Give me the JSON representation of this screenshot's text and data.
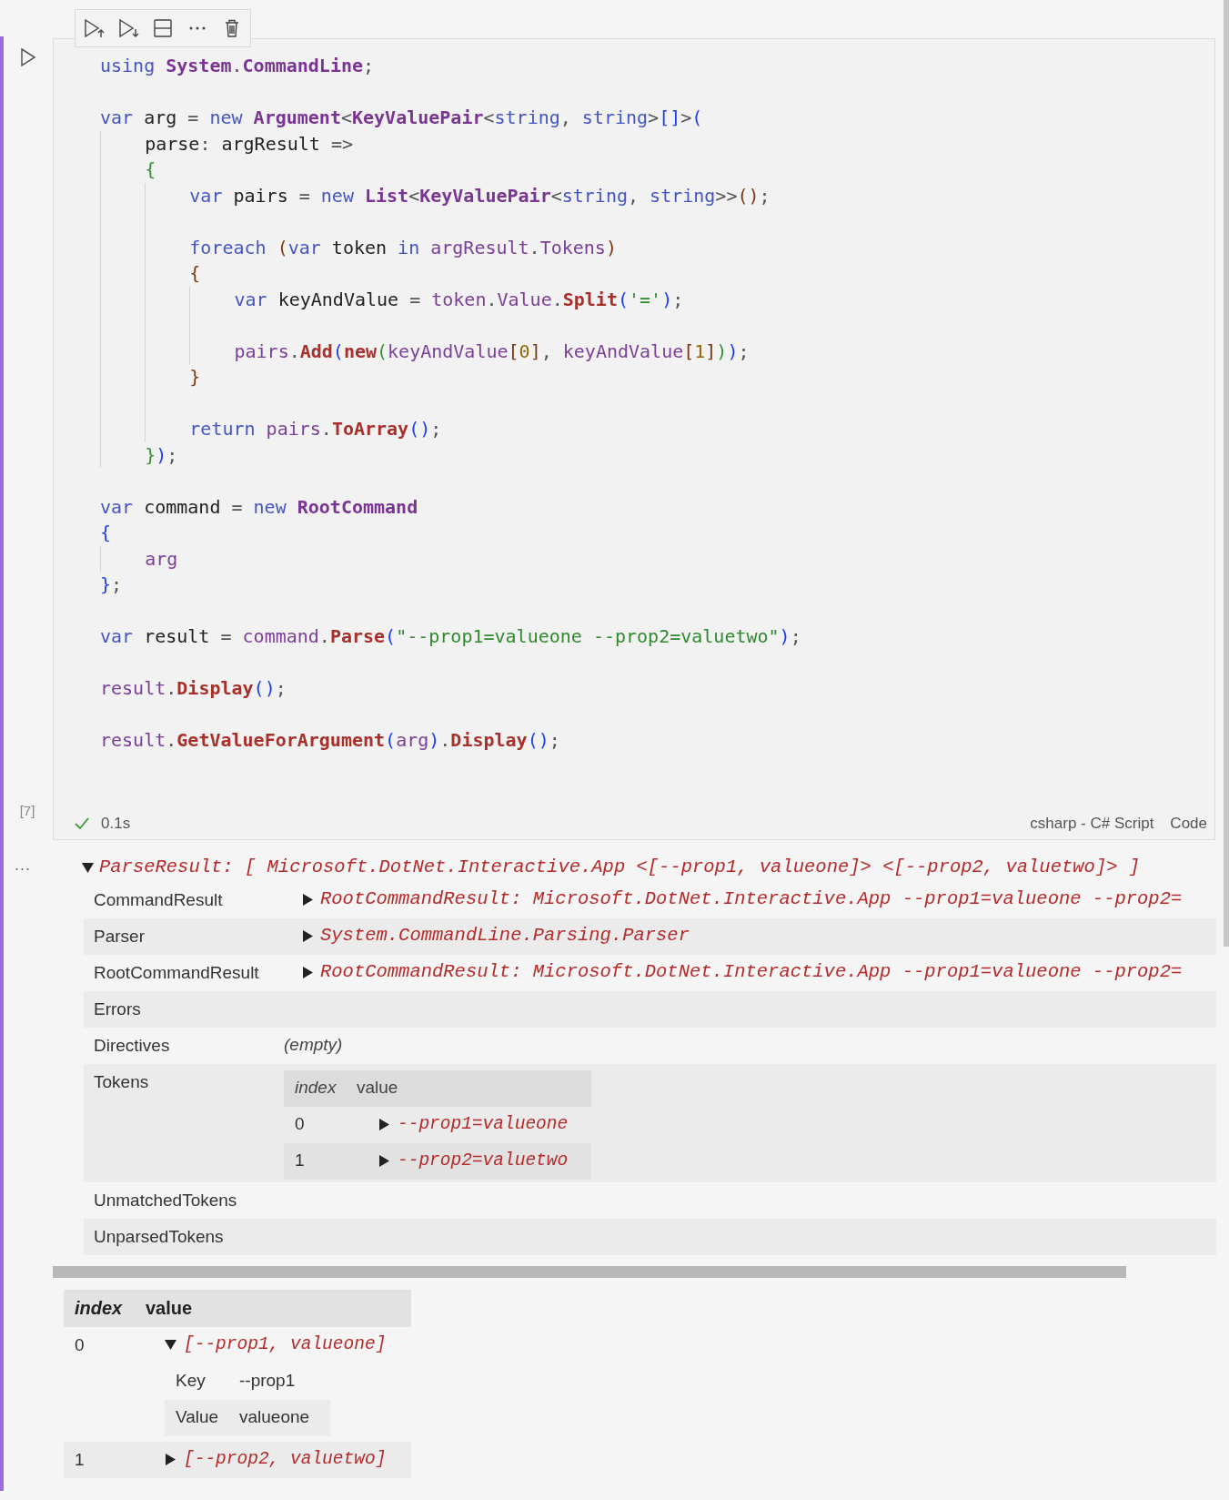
{
  "cell": {
    "execution_count": "[7]",
    "succeeded": true,
    "duration": "0.1s",
    "language": "csharp - C# Script",
    "cell_type": "Code",
    "code": [
      {
        "kind": "code",
        "tokens": [
          {
            "kind": "kw",
            "text": "using "
          },
          {
            "kind": "type",
            "text": "System"
          },
          {
            "kind": "p",
            "text": "."
          },
          {
            "kind": "type",
            "text": "CommandLine"
          },
          {
            "kind": "p",
            "text": ";"
          }
        ]
      },
      {
        "kind": "blank"
      },
      {
        "kind": "code",
        "tokens": [
          {
            "kind": "kw",
            "text": "var"
          },
          {
            "kind": "id",
            "text": " arg"
          },
          {
            "kind": "p",
            "text": " = "
          },
          {
            "kind": "kw",
            "text": "new "
          },
          {
            "kind": "type",
            "text": "Argument"
          },
          {
            "kind": "p",
            "text": "<"
          },
          {
            "kind": "type",
            "text": "KeyValuePair"
          },
          {
            "kind": "p",
            "text": "<"
          },
          {
            "kind": "kw",
            "text": "string"
          },
          {
            "kind": "p",
            "text": ", "
          },
          {
            "kind": "kw",
            "text": "string"
          },
          {
            "kind": "p",
            "text": ">"
          },
          {
            "kind": "b1",
            "text": "[]"
          },
          {
            "kind": "p",
            "text": ">"
          },
          {
            "kind": "b1",
            "text": "("
          }
        ]
      },
      {
        "kind": "block",
        "lines": [
          {
            "kind": "code",
            "tokens": [
              {
                "kind": "id",
                "text": "parse"
              },
              {
                "kind": "p",
                "text": ": "
              },
              {
                "kind": "id",
                "text": "argResult"
              },
              {
                "kind": "p",
                "text": " =>"
              }
            ]
          },
          {
            "kind": "code",
            "tokens": [
              {
                "kind": "b2",
                "text": "{"
              }
            ]
          },
          {
            "kind": "block",
            "lines": [
              {
                "kind": "code",
                "tokens": [
                  {
                    "kind": "kw",
                    "text": "var"
                  },
                  {
                    "kind": "id",
                    "text": " pairs"
                  },
                  {
                    "kind": "p",
                    "text": " = "
                  },
                  {
                    "kind": "kw",
                    "text": "new "
                  },
                  {
                    "kind": "type",
                    "text": "List"
                  },
                  {
                    "kind": "p",
                    "text": "<"
                  },
                  {
                    "kind": "type",
                    "text": "KeyValuePair"
                  },
                  {
                    "kind": "p",
                    "text": "<"
                  },
                  {
                    "kind": "kw",
                    "text": "string"
                  },
                  {
                    "kind": "p",
                    "text": ", "
                  },
                  {
                    "kind": "kw",
                    "text": "string"
                  },
                  {
                    "kind": "p",
                    "text": ">>"
                  },
                  {
                    "kind": "b3",
                    "text": "()"
                  },
                  {
                    "kind": "p",
                    "text": ";"
                  }
                ]
              },
              {
                "kind": "blank"
              },
              {
                "kind": "code",
                "tokens": [
                  {
                    "kind": "kw",
                    "text": "foreach "
                  },
                  {
                    "kind": "b3",
                    "text": "("
                  },
                  {
                    "kind": "kw",
                    "text": "var"
                  },
                  {
                    "kind": "id",
                    "text": " token "
                  },
                  {
                    "kind": "kw",
                    "text": "in "
                  },
                  {
                    "kind": "mem",
                    "text": "argResult"
                  },
                  {
                    "kind": "p",
                    "text": "."
                  },
                  {
                    "kind": "mem",
                    "text": "Tokens"
                  },
                  {
                    "kind": "b3",
                    "text": ")"
                  }
                ]
              },
              {
                "kind": "code",
                "tokens": [
                  {
                    "kind": "b3",
                    "text": "{"
                  }
                ]
              },
              {
                "kind": "block",
                "lines": [
                  {
                    "kind": "code",
                    "tokens": [
                      {
                        "kind": "kw",
                        "text": "var"
                      },
                      {
                        "kind": "id",
                        "text": " keyAndValue"
                      },
                      {
                        "kind": "p",
                        "text": " = "
                      },
                      {
                        "kind": "mem",
                        "text": "token"
                      },
                      {
                        "kind": "p",
                        "text": "."
                      },
                      {
                        "kind": "mem",
                        "text": "Value"
                      },
                      {
                        "kind": "p",
                        "text": "."
                      },
                      {
                        "kind": "fn",
                        "text": "Split"
                      },
                      {
                        "kind": "b1",
                        "text": "("
                      },
                      {
                        "kind": "str",
                        "text": "'='"
                      },
                      {
                        "kind": "b1",
                        "text": ")"
                      },
                      {
                        "kind": "p",
                        "text": ";"
                      }
                    ]
                  },
                  {
                    "kind": "blank"
                  },
                  {
                    "kind": "code",
                    "tokens": [
                      {
                        "kind": "mem",
                        "text": "pairs"
                      },
                      {
                        "kind": "p",
                        "text": "."
                      },
                      {
                        "kind": "fn",
                        "text": "Add"
                      },
                      {
                        "kind": "b1",
                        "text": "("
                      },
                      {
                        "kind": "fn",
                        "text": "new"
                      },
                      {
                        "kind": "b2",
                        "text": "("
                      },
                      {
                        "kind": "mem",
                        "text": "keyAndValue"
                      },
                      {
                        "kind": "b3",
                        "text": "["
                      },
                      {
                        "kind": "num",
                        "text": "0"
                      },
                      {
                        "kind": "b3",
                        "text": "]"
                      },
                      {
                        "kind": "p",
                        "text": ", "
                      },
                      {
                        "kind": "mem",
                        "text": "keyAndValue"
                      },
                      {
                        "kind": "b3",
                        "text": "["
                      },
                      {
                        "kind": "num",
                        "text": "1"
                      },
                      {
                        "kind": "b3",
                        "text": "]"
                      },
                      {
                        "kind": "b2",
                        "text": ")"
                      },
                      {
                        "kind": "b1",
                        "text": ")"
                      },
                      {
                        "kind": "p",
                        "text": ";"
                      }
                    ]
                  }
                ]
              },
              {
                "kind": "code",
                "tokens": [
                  {
                    "kind": "b3",
                    "text": "}"
                  }
                ]
              },
              {
                "kind": "blank"
              },
              {
                "kind": "code",
                "tokens": [
                  {
                    "kind": "kw",
                    "text": "return "
                  },
                  {
                    "kind": "mem",
                    "text": "pairs"
                  },
                  {
                    "kind": "p",
                    "text": "."
                  },
                  {
                    "kind": "fn",
                    "text": "ToArray"
                  },
                  {
                    "kind": "b1",
                    "text": "()"
                  },
                  {
                    "kind": "p",
                    "text": ";"
                  }
                ]
              }
            ]
          },
          {
            "kind": "code",
            "tokens": [
              {
                "kind": "b2",
                "text": "}"
              },
              {
                "kind": "b1",
                "text": ")"
              },
              {
                "kind": "p",
                "text": ";"
              }
            ]
          }
        ]
      },
      {
        "kind": "blank"
      },
      {
        "kind": "code",
        "tokens": [
          {
            "kind": "kw",
            "text": "var"
          },
          {
            "kind": "id",
            "text": " command"
          },
          {
            "kind": "p",
            "text": " = "
          },
          {
            "kind": "kw",
            "text": "new "
          },
          {
            "kind": "type",
            "text": "RootCommand"
          }
        ]
      },
      {
        "kind": "code",
        "tokens": [
          {
            "kind": "b1",
            "text": "{"
          }
        ]
      },
      {
        "kind": "block",
        "lines": [
          {
            "kind": "code",
            "tokens": [
              {
                "kind": "mem",
                "text": "arg"
              }
            ]
          }
        ]
      },
      {
        "kind": "code",
        "tokens": [
          {
            "kind": "b1",
            "text": "}"
          },
          {
            "kind": "p",
            "text": ";"
          }
        ]
      },
      {
        "kind": "blank"
      },
      {
        "kind": "code",
        "tokens": [
          {
            "kind": "kw",
            "text": "var"
          },
          {
            "kind": "id",
            "text": " result"
          },
          {
            "kind": "p",
            "text": " = "
          },
          {
            "kind": "mem",
            "text": "command"
          },
          {
            "kind": "p",
            "text": "."
          },
          {
            "kind": "fn",
            "text": "Parse"
          },
          {
            "kind": "b1",
            "text": "("
          },
          {
            "kind": "str",
            "text": "\"--prop1=valueone --prop2=valuetwo\""
          },
          {
            "kind": "b1",
            "text": ")"
          },
          {
            "kind": "p",
            "text": ";"
          }
        ]
      },
      {
        "kind": "blank"
      },
      {
        "kind": "code",
        "tokens": [
          {
            "kind": "mem",
            "text": "result"
          },
          {
            "kind": "p",
            "text": "."
          },
          {
            "kind": "fn",
            "text": "Display"
          },
          {
            "kind": "b1",
            "text": "()"
          },
          {
            "kind": "p",
            "text": ";"
          }
        ]
      },
      {
        "kind": "blank"
      },
      {
        "kind": "code",
        "tokens": [
          {
            "kind": "mem",
            "text": "result"
          },
          {
            "kind": "p",
            "text": "."
          },
          {
            "kind": "fn",
            "text": "GetValueForArgument"
          },
          {
            "kind": "b1",
            "text": "("
          },
          {
            "kind": "mem",
            "text": "arg"
          },
          {
            "kind": "b1",
            "text": ")"
          },
          {
            "kind": "p",
            "text": "."
          },
          {
            "kind": "fn",
            "text": "Display"
          },
          {
            "kind": "b1",
            "text": "()"
          },
          {
            "kind": "p",
            "text": ";"
          }
        ]
      }
    ]
  },
  "output": {
    "more": "...",
    "summary": {
      "text": "ParseResult: [ Microsoft.DotNet.Interactive.App <[--prop1, valueone]> <[--prop2, valuetwo]> ]",
      "expanded": true
    },
    "rows": [
      {
        "label": "CommandResult",
        "value": {
          "kind": "object",
          "text": "RootCommandResult: Microsoft.DotNet.Interactive.App --prop1=valueone --prop2=",
          "expanded": false
        }
      },
      {
        "label": "Parser",
        "value": {
          "kind": "object",
          "text": "System.CommandLine.Parsing.Parser",
          "expanded": false
        }
      },
      {
        "label": "RootCommandResult",
        "value": {
          "kind": "object",
          "text": "RootCommandResult: Microsoft.DotNet.Interactive.App --prop1=valueone --prop2=",
          "expanded": false
        }
      },
      {
        "label": "Errors"
      },
      {
        "label": "Directives",
        "value": {
          "kind": "empty",
          "text": "(empty)"
        }
      },
      {
        "label": "Tokens",
        "value": {
          "kind": "table",
          "columns": [
            "index",
            "value"
          ],
          "rows": [
            {
              "index": "0",
              "text": "--prop1=valueone",
              "expanded": false
            },
            {
              "index": "1",
              "text": "--prop2=valuetwo",
              "expanded": false
            }
          ]
        }
      },
      {
        "label": "UnmatchedTokens"
      },
      {
        "label": "UnparsedTokens"
      }
    ]
  },
  "result_table": {
    "columns": [
      "index",
      "value"
    ],
    "rows": [
      {
        "index": "0",
        "text": "[--prop1, valueone]",
        "expanded": true,
        "fields": [
          {
            "key": "Key",
            "value": "--prop1"
          },
          {
            "key": "Value",
            "value": "valueone"
          }
        ]
      },
      {
        "index": "1",
        "text": "[--prop2, valuetwo]",
        "expanded": false
      }
    ]
  }
}
